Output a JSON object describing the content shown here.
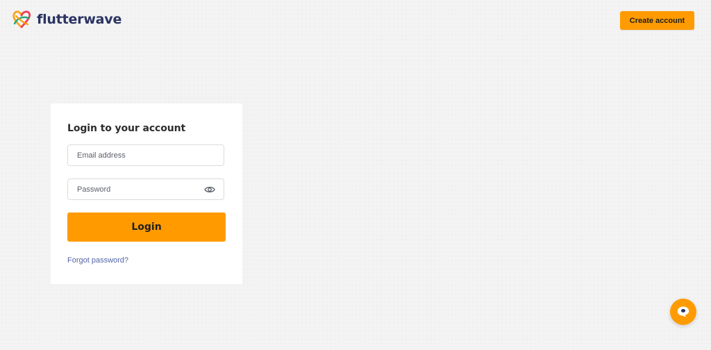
{
  "brand": {
    "name": "flutterwave",
    "text_color": "#2a3362",
    "accent_color": "#ff9b00"
  },
  "header": {
    "create_account_label": "Create account"
  },
  "login_card": {
    "title": "Login to your account",
    "email": {
      "value": "",
      "placeholder": "Email address"
    },
    "password": {
      "value": "",
      "placeholder": "Password",
      "toggle_icon": "eye-icon"
    },
    "login_label": "Login",
    "forgot_password_label": "Forgot password?"
  },
  "chat_widget": {
    "icon": "chat-bubble-icon"
  }
}
